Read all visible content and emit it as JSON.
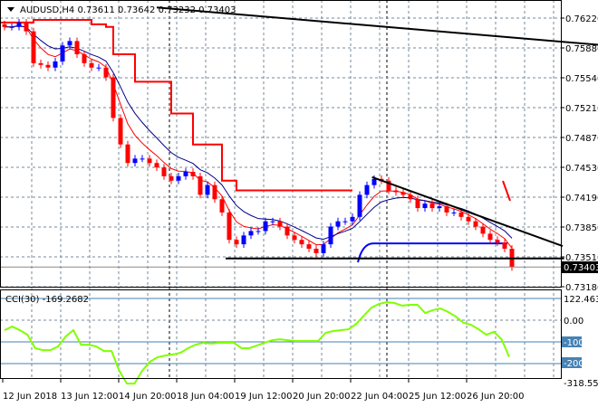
{
  "header": {
    "symbol": "AUDUSD,H4",
    "open": "0.73611",
    "high": "0.73642",
    "low": "0.73232",
    "close": "0.73403"
  },
  "cci": {
    "label": "CCI(30) -169.2682",
    "axis": [
      "122.4634",
      "0.00",
      "-100",
      "-200",
      "-318.5593"
    ],
    "levels": [
      100,
      -100,
      -200
    ]
  },
  "colors": {
    "bull": "#0000ff",
    "bear": "#ff0000",
    "cci": "#80ff00",
    "level": "#4682b4",
    "red_ma": "#ff0000",
    "blue_ma": "#00008b"
  },
  "chart_data": {
    "type": "candlestick",
    "title": "AUDUSD,H4",
    "price_ticks": [
      "0.76220",
      "0.75880",
      "0.75540",
      "0.75210",
      "0.74870",
      "0.74530",
      "0.74190",
      "0.73850",
      "0.73510",
      "0.73180"
    ],
    "current_price": "0.73403",
    "ylim": [
      0.7315,
      0.7642
    ],
    "time_labels": [
      "12 Jun 2018",
      "13 Jun 12:00",
      "14 Jun 20:00",
      "18 Jun 04:00",
      "19 Jun 12:00",
      "20 Jun 20:00",
      "22 Jun 04:00",
      "25 Jun 12:00",
      "26 Jun 20:00"
    ],
    "closes": [
      0.7612,
      0.7612,
      0.7617,
      0.7607,
      0.7571,
      0.7569,
      0.7566,
      0.7573,
      0.7591,
      0.7596,
      0.7581,
      0.7571,
      0.7566,
      0.7566,
      0.7555,
      0.7509,
      0.7479,
      0.7458,
      0.7463,
      0.7463,
      0.7458,
      0.7453,
      0.7443,
      0.7438,
      0.7443,
      0.7448,
      0.7443,
      0.7422,
      0.7433,
      0.7417,
      0.7402,
      0.7371,
      0.7366,
      0.7376,
      0.7381,
      0.7381,
      0.7392,
      0.7392,
      0.7386,
      0.7376,
      0.7371,
      0.7366,
      0.7361,
      0.7356,
      0.7366,
      0.7386,
      0.7392,
      0.7392,
      0.7397,
      0.7422,
      0.7433,
      0.744,
      0.7438,
      0.7427,
      0.7425,
      0.7422,
      0.7417,
      0.7407,
      0.7412,
      0.7407,
      0.7409,
      0.7402,
      0.7402,
      0.7397,
      0.7392,
      0.7386,
      0.7378,
      0.7371,
      0.7368,
      0.7361,
      0.734
    ],
    "step_line": [
      0.7617,
      0.7617,
      0.7617,
      0.7617,
      0.762,
      0.762,
      0.762,
      0.762,
      0.762,
      0.762,
      0.762,
      0.762,
      0.7615,
      0.7615,
      0.7612,
      0.7581,
      0.7581,
      0.7581,
      0.755,
      0.755,
      0.755,
      0.755,
      0.755,
      0.7514,
      0.7514,
      0.7514,
      0.7479,
      0.7479,
      0.7479,
      0.7479,
      0.7438,
      0.7438,
      0.7427,
      0.7427,
      0.7427,
      0.7427,
      0.7427,
      0.7427,
      0.7427,
      0.7427,
      0.7427,
      0.7427,
      0.7427,
      0.7427,
      0.7427,
      0.7427,
      0.7427,
      0.7427,
      0.7427
    ],
    "trendlines": [
      {
        "from": [
          0.7634,
          21
        ],
        "to": [
          0.7591,
          77
        ]
      },
      {
        "from": [
          0.7442,
          50.7
        ],
        "to": [
          0.7364,
          71
        ]
      },
      {
        "from": [
          0.735,
          30.5
        ],
        "to": [
          0.735,
          71.2
        ]
      }
    ],
    "support_blue": 0.7367,
    "cci_values": [
      -46,
      -29,
      -46,
      -67,
      -129,
      -138,
      -138,
      -121,
      -75,
      -46,
      -113,
      -113,
      -121,
      -142,
      -142,
      -233,
      -292,
      -292,
      -233,
      -192,
      -171,
      -163,
      -158,
      -150,
      -129,
      -113,
      -104,
      -108,
      -104,
      -104,
      -104,
      -129,
      -129,
      -117,
      -104,
      -92,
      -88,
      -92,
      -96,
      -96,
      -96,
      -96,
      -58,
      -50,
      -46,
      -42,
      -17,
      21,
      58,
      75,
      83,
      79,
      67,
      71,
      71,
      33,
      46,
      54,
      38,
      17,
      -12,
      -21,
      -42,
      -67,
      -54,
      -88,
      -169
    ]
  }
}
